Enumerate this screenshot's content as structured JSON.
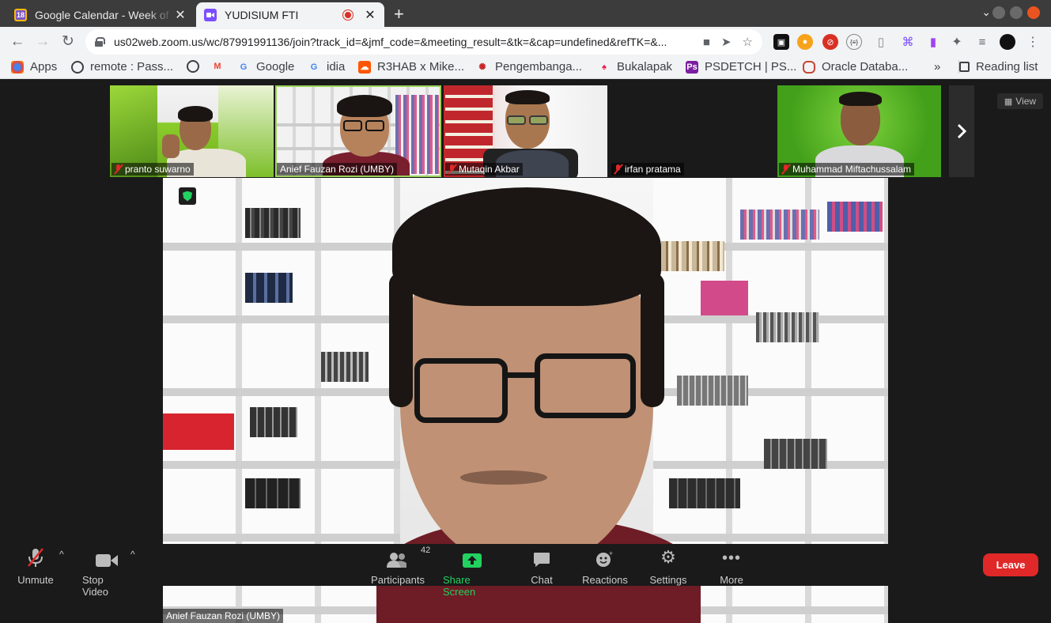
{
  "browser": {
    "tabs": [
      {
        "title": "Google Calendar - Week of",
        "favicon": "calendar-icon",
        "favicon_text": "18"
      },
      {
        "title": "YUDISIUM FTI",
        "favicon": "zoom-icon",
        "recording": true
      }
    ],
    "url": "us02web.zoom.us/wc/87991991136/join?track_id=&jmf_code=&meeting_result=&tk=&cap=undefined&refTK=&..."
  },
  "bookmarks": [
    {
      "label": "Apps",
      "icon": "apps-grid-icon"
    },
    {
      "label": "remote : Pass...",
      "icon": "globe-icon"
    },
    {
      "label": "",
      "icon": "globe-icon"
    },
    {
      "label": "",
      "icon": "gmail-icon"
    },
    {
      "label": "Google",
      "icon": "google-icon"
    },
    {
      "label": "idia",
      "icon": "google-icon"
    },
    {
      "label": "R3HAB x Mike...",
      "icon": "soundcloud-icon"
    },
    {
      "label": "Pengembanga...",
      "icon": "bookmark-icon"
    },
    {
      "label": "Bukalapak",
      "icon": "bukalapak-icon"
    },
    {
      "label": "PSDETCH | PS...",
      "icon": "ps-icon"
    },
    {
      "label": "Oracle Databa...",
      "icon": "oracle-icon"
    }
  ],
  "bookmarks_more": "»",
  "reading_list": "Reading list",
  "meeting": {
    "participants": [
      {
        "name": "pranto suwarno",
        "muted": true
      },
      {
        "name": "Anief Fauzan Rozi (UMBY)",
        "muted": false,
        "active": true
      },
      {
        "name": "Mutaqin Akbar",
        "muted": true
      },
      {
        "name": "irfan pratama",
        "muted": true
      },
      {
        "name": "Muhammad Miftachussalam",
        "muted": true
      }
    ],
    "view_label": "View",
    "speaker_name": "Anief Fauzan Rozi (UMBY)",
    "participant_count": "42"
  },
  "controls": {
    "unmute": "Unmute",
    "stop_video": "Stop Video",
    "participants": "Participants",
    "share_screen": "Share Screen",
    "chat": "Chat",
    "reactions": "Reactions",
    "settings": "Settings",
    "more": "More",
    "leave": "Leave"
  },
  "colors": {
    "leave": "#e02828",
    "share_screen": "#23d160",
    "active_speaker_border": "#9bd35a"
  }
}
